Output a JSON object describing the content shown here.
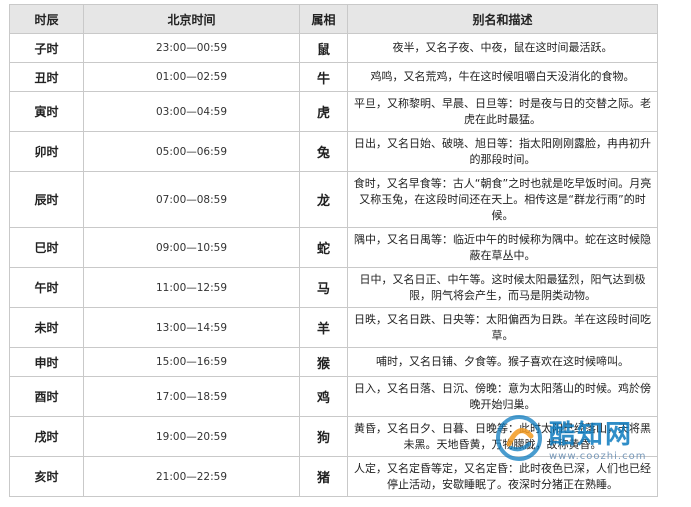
{
  "table": {
    "headers": [
      "时辰",
      "北京时间",
      "属相",
      "别名和描述"
    ],
    "rows": [
      [
        "子时",
        "23:00—00:59",
        "鼠",
        "夜半，又名子夜、中夜，鼠在这时间最活跃。"
      ],
      [
        "丑时",
        "01:00—02:59",
        "牛",
        "鸡鸣，又名荒鸡，牛在这时候咀嚼白天没消化的食物。"
      ],
      [
        "寅时",
        "03:00—04:59",
        "虎",
        "平旦，又称黎明、早晨、日旦等：时是夜与日的交替之际。老虎在此时最猛。"
      ],
      [
        "卯时",
        "05:00—06:59",
        "兔",
        "日出，又名日始、破晓、旭日等：指太阳刚刚露脸，冉冉初升的那段时间。"
      ],
      [
        "辰时",
        "07:00—08:59",
        "龙",
        "食时，又名早食等：古人“朝食”之时也就是吃早饭时间。月亮又称玉兔，在这段时间还在天上。相传这是“群龙行雨”的时候。"
      ],
      [
        "巳时",
        "09:00—10:59",
        "蛇",
        "隅中，又名日禺等：临近中午的时候称为隅中。蛇在这时候隐蔽在草丛中。"
      ],
      [
        "午时",
        "11:00—12:59",
        "马",
        "日中，又名日正、中午等。这时候太阳最猛烈，阳气达到极限，阴气将会产生，而马是阴类动物。"
      ],
      [
        "未时",
        "13:00—14:59",
        "羊",
        "日昳，又名日跌、日央等：太阳偏西为日跌。羊在这段时间吃草。"
      ],
      [
        "申时",
        "15:00—16:59",
        "猴",
        "哺时，又名日铺、夕食等。猴子喜欢在这时候啼叫。"
      ],
      [
        "酉时",
        "17:00—18:59",
        "鸡",
        "日入，又名日落、日沉、傍晚：意为太阳落山的时候。鸡於傍晚开始归巢。"
      ],
      [
        "戌时",
        "19:00—20:59",
        "狗",
        "黄昏，又名日夕、日暮、日晚等：此时太阳已经落山，天将黑未黑。天地昏黄，万物朦胧，故称黄昏。"
      ],
      [
        "亥时",
        "21:00—22:59",
        "猪",
        "人定，又名定昏等定，又名定昏：此时夜色已深，人们也已经停止活动，安歇睡眠了。夜深时分猪正在熟睡。"
      ]
    ]
  },
  "watermark": {
    "name": "酷知网",
    "url": "www.coozhi.com",
    "colors": {
      "blue": "#0c7bbf",
      "orange": "#f39a1e"
    }
  }
}
